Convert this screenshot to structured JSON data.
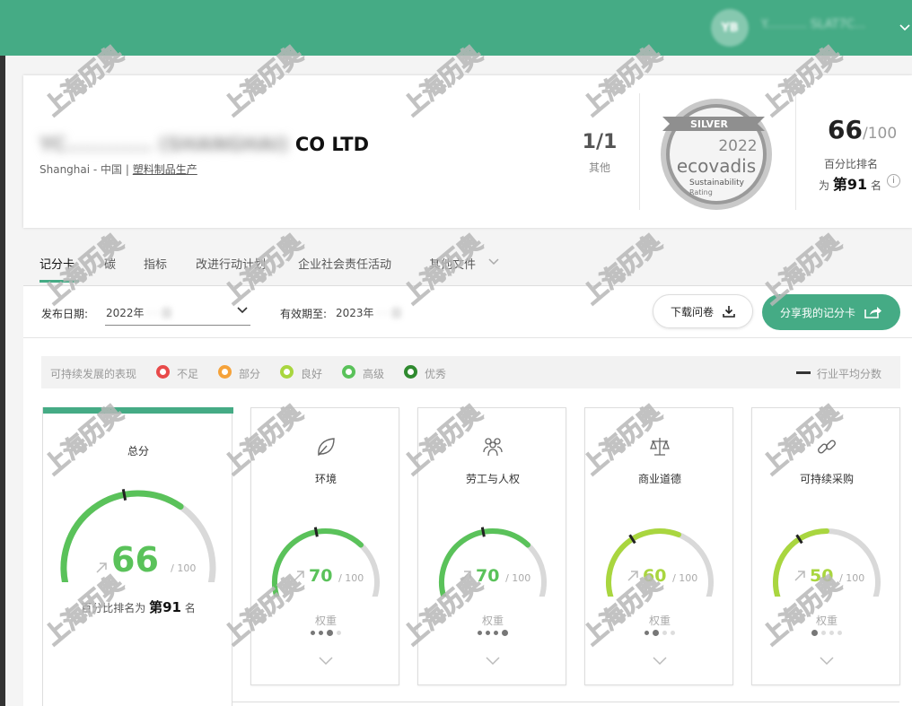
{
  "header": {
    "avatar_initials": "YB",
    "username": "Y........... SLAT7C..."
  },
  "company": {
    "name_blurred": "YC............ (SHANGHAI)",
    "name_suffix": "CO LTD",
    "location": "Shanghai - 中国",
    "separator": "|",
    "industry": "塑料制品生产",
    "rank_fraction": "1/1",
    "rank_fraction_label": "其他",
    "medal": {
      "level": "SILVER",
      "year": "2022",
      "brand": "ecovadis",
      "subtitle_line1": "Sustainability",
      "subtitle_line2": "Rating"
    },
    "score": "66",
    "score_of": "/100",
    "percentile_label": "百分比排名",
    "percentile_prefix": "为",
    "percentile_rank": "第91",
    "percentile_suffix": "名",
    "info_icon": "i"
  },
  "tabs": [
    {
      "label": "记分卡",
      "active": true
    },
    {
      "label": "碳",
      "active": false
    },
    {
      "label": "指标",
      "active": false
    },
    {
      "label": "改进行动计划",
      "active": false
    },
    {
      "label": "企业社会责任活动",
      "active": false
    },
    {
      "label": "其他文件",
      "active": false
    }
  ],
  "filters": {
    "publish_label": "发布日期:",
    "publish_value": "2022年",
    "publish_value_blurred": "  ·  ·  日",
    "valid_label": "有效期至:",
    "valid_value": "2023年",
    "valid_value_blurred": "  ·  ·  日",
    "download_button": "下载问卷",
    "share_button": "分享我的记分卡"
  },
  "legend": {
    "title": "可持续发展的表现",
    "items": [
      {
        "label": "不足",
        "color": "#e84a4a"
      },
      {
        "label": "部分",
        "color": "#f5a23a"
      },
      {
        "label": "良好",
        "color": "#a9d63f"
      },
      {
        "label": "高级",
        "color": "#5ac25a"
      },
      {
        "label": "优秀",
        "color": "#2f8a2f"
      }
    ],
    "average_label": "行业平均分数"
  },
  "overall": {
    "title": "总分",
    "score": "66",
    "score_of": "/ 100",
    "rank_prefix": "百分比排名为",
    "rank_value": "第91",
    "rank_suffix": "名",
    "level_color": "#5ac25a",
    "score_value": 66,
    "industry_avg": 45
  },
  "themes": [
    {
      "title": "环境",
      "icon": "leaf-icon",
      "score": "70",
      "score_value": 70,
      "score_of": "/ 100",
      "industry_avg": 45,
      "color": "#5ac25a",
      "weight_label": "权重",
      "weight": 3
    },
    {
      "title": "劳工与人权",
      "icon": "people-icon",
      "score": "70",
      "score_value": 70,
      "score_of": "/ 100",
      "industry_avg": 45,
      "color": "#5ac25a",
      "weight_label": "权重",
      "weight": 4
    },
    {
      "title": "商业道德",
      "icon": "scales-icon",
      "score": "60",
      "score_value": 60,
      "score_of": "/ 100",
      "industry_avg": 35,
      "color": "#a9d63f",
      "weight_label": "权重",
      "weight": 2
    },
    {
      "title": "可持续采购",
      "icon": "link-icon",
      "score": "50",
      "score_value": 50,
      "score_of": "/ 100",
      "industry_avg": 35,
      "color": "#a9d63f",
      "weight_label": "权重",
      "weight": 1
    }
  ],
  "watermark_text": "上海历奥"
}
